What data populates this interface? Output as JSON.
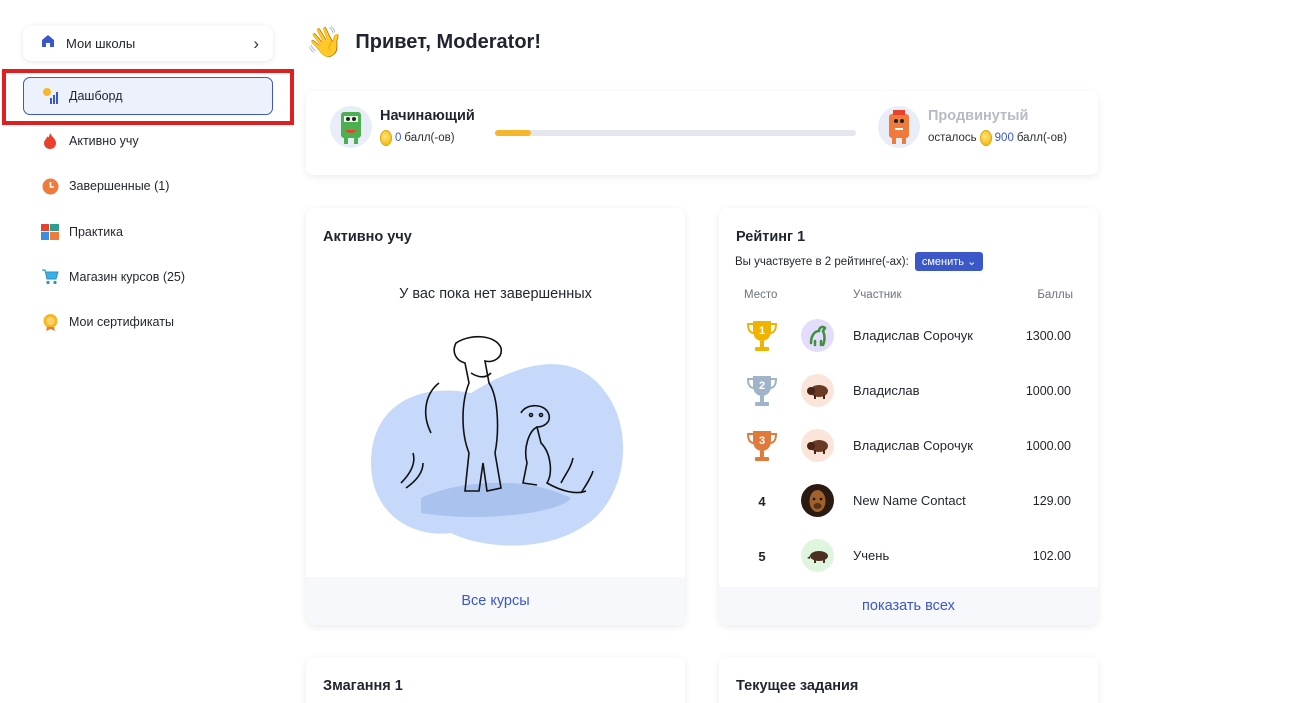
{
  "sidebar": {
    "school_switch_label": "Мои школы",
    "items": [
      {
        "label": "Дашборд",
        "active": true,
        "icon": "chart-icon"
      },
      {
        "label": "Активно учу",
        "icon": "fire-icon"
      },
      {
        "label": "Завершенные (1)",
        "icon": "clock-icon"
      },
      {
        "label": "Практика",
        "icon": "grid-icon"
      },
      {
        "label": "Магазин курсов (25)",
        "icon": "cart-icon"
      },
      {
        "label": "Мои сертификаты",
        "icon": "badge-icon"
      }
    ]
  },
  "greeting": {
    "emoji": "👋",
    "text": "Привет, Moderator!"
  },
  "level": {
    "current": {
      "title": "Начинающий",
      "points": "0",
      "points_suffix": "балл(-ов)"
    },
    "next": {
      "title": "Продвинутый",
      "prefix": "осталось",
      "points": "900",
      "points_suffix": "балл(-ов)"
    },
    "progress": 0.1
  },
  "active_card": {
    "title": "Активно учу",
    "empty_text": "У вас пока нет завершенных",
    "footer": "Все курсы"
  },
  "rating_card": {
    "title": "Рейтинг 1",
    "subtitle": "Вы участвуете в 2 рейтинге(-ах):",
    "switch_label": "сменить",
    "headers": {
      "place": "Место",
      "participant": "Участник",
      "points": "Баллы"
    },
    "rows": [
      {
        "place": "1",
        "name": "Владислав Сорочук",
        "score": "1300.00"
      },
      {
        "place": "2",
        "name": "Владислав",
        "score": "1000.00"
      },
      {
        "place": "3",
        "name": "Владислав Сорочук",
        "score": "1000.00"
      },
      {
        "place": "4",
        "name": "New Name Contact",
        "score": "129.00"
      },
      {
        "place": "5",
        "name": "Учень",
        "score": "102.00"
      }
    ],
    "footer": "показать всех"
  },
  "bottom_cards": {
    "left_title": "Змагання 1",
    "right_title": "Текущее задания"
  },
  "colors": {
    "accent": "#3b57c8",
    "highlight": "#e02020",
    "gold": "#f0b400",
    "silver": "#9fb4c9",
    "bronze": "#e07a3c"
  }
}
